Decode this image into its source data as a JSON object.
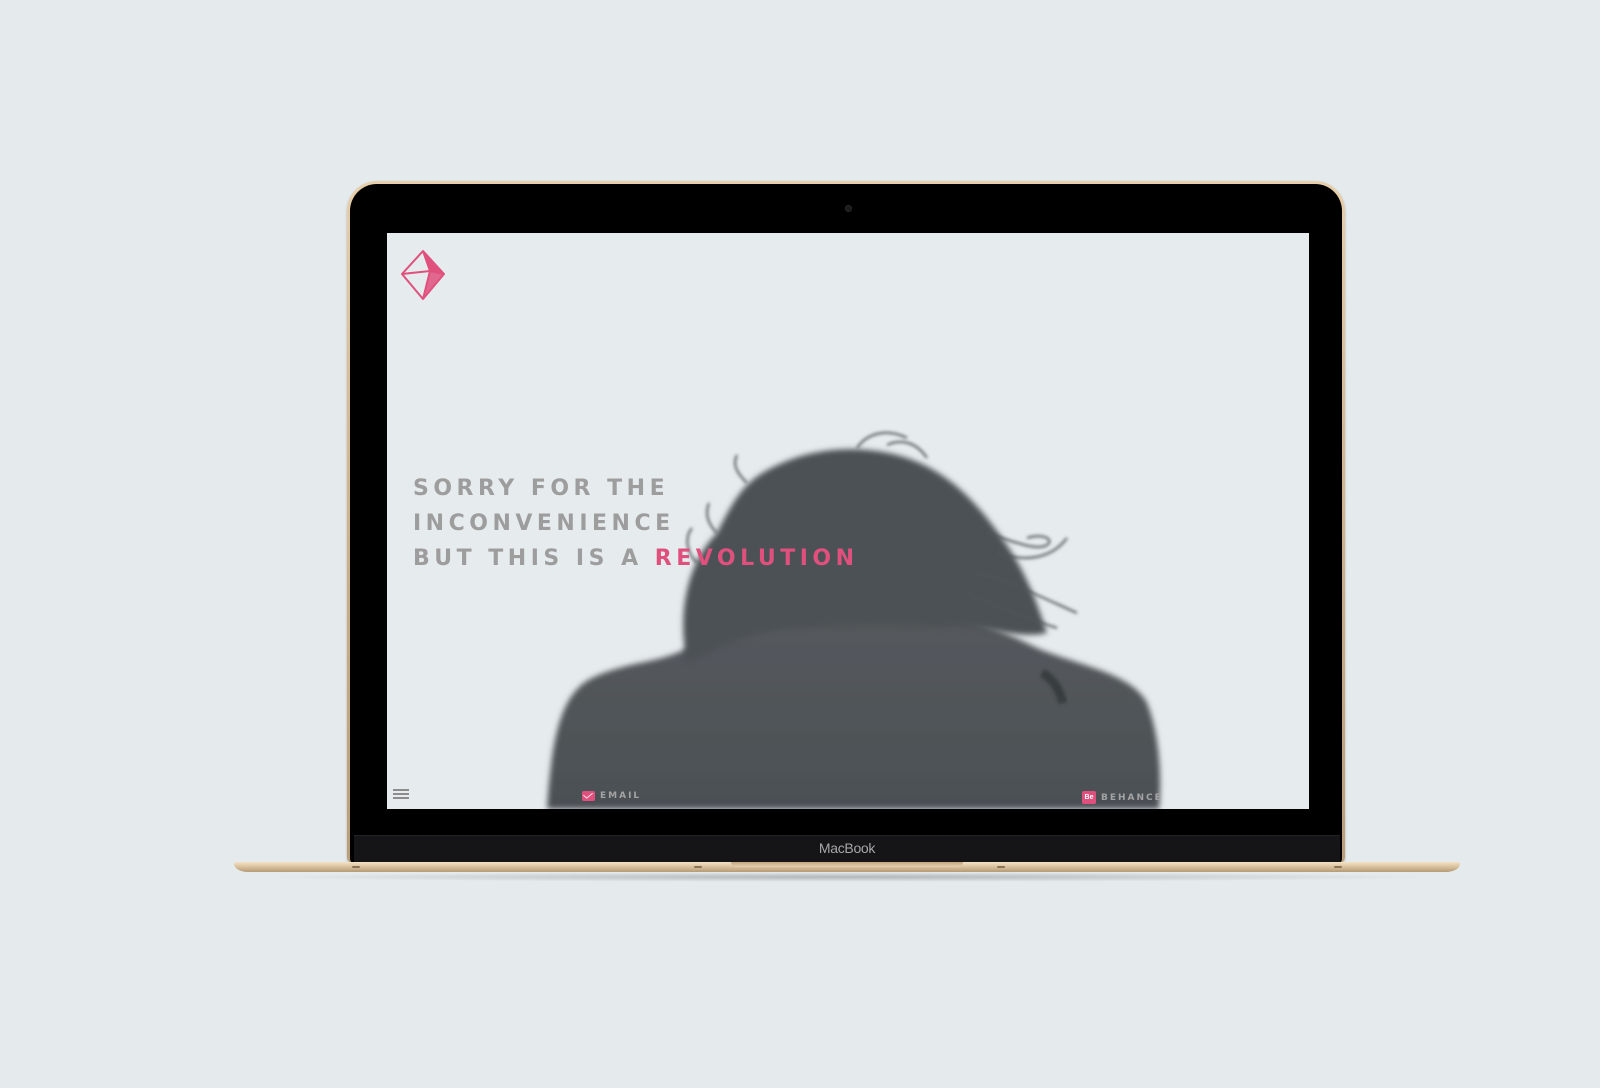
{
  "device": {
    "model_label": "MacBook"
  },
  "page": {
    "headline": {
      "line1": "SORRY FOR THE",
      "line2": "INCONVENIENCE",
      "line3_prefix": "BUT THIS IS A ",
      "line3_accent": "REVOLUTION"
    },
    "footer": {
      "email_label": "EMAIL",
      "behance_label": "BEHANCE",
      "behance_icon_text": "Be"
    }
  },
  "colors": {
    "accent": "#e0507d",
    "background": "#e6ebee",
    "text_muted": "#9d9d9d",
    "photo_figure": "#4f5458"
  },
  "icons": {
    "logo": "diamond-logo-icon",
    "menu": "hamburger-menu-icon",
    "email": "envelope-icon",
    "behance": "behance-icon"
  }
}
